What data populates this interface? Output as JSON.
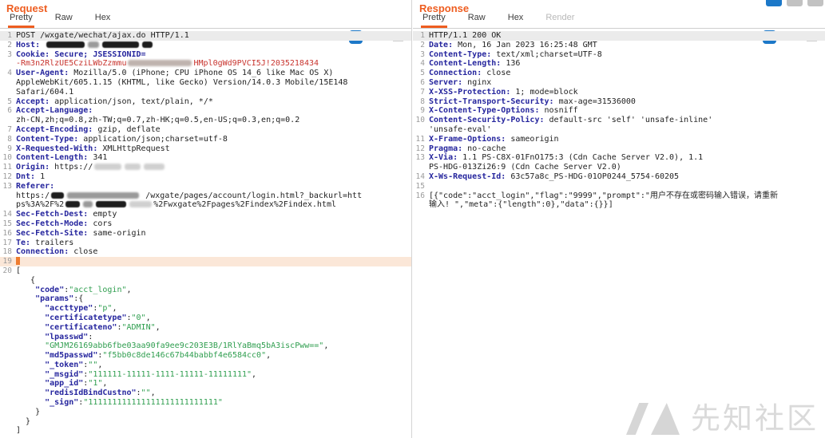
{
  "colors": {
    "accent_orange": "#ee5d20",
    "header_name_blue": "#26269e",
    "json_string_green": "#2f9e4f",
    "cookie_red": "#c8342e",
    "icon_blue": "#1c78c8",
    "selected_line_bg": "#ebebeb",
    "caret_line_bg": "#fbe7d8"
  },
  "watermark": {
    "text": "先知社区",
    "logo": "xianzhi-logo"
  },
  "panels": [
    {
      "id": "request",
      "title": "Request",
      "tabs": [
        {
          "label": "Pretty",
          "state": "active"
        },
        {
          "label": "Raw",
          "state": "normal"
        },
        {
          "label": "Hex",
          "state": "normal"
        }
      ],
      "toolbar": {
        "wrap_icon": "word-wrap-icon",
        "newline_label": "\\n",
        "menu_icon": "hamburger-menu-icon"
      },
      "lines": [
        {
          "n": "1",
          "bg": "sel",
          "s": [
            [
              "t",
              "POST /wxgate/wechat/ajax.do HTTP/1.1"
            ]
          ]
        },
        {
          "n": "2",
          "s": [
            [
              "h",
              "Host:"
            ],
            [
              "t",
              " "
            ],
            [
              "bar-d",
              48
            ],
            [
              "bar-g",
              14
            ],
            [
              "bar-d",
              46
            ],
            [
              "bar-d",
              13
            ]
          ]
        },
        {
          "n": "3",
          "s": [
            [
              "h",
              "Cookie:"
            ],
            [
              "t",
              " "
            ],
            [
              "h",
              "Secure; JSESSIONID="
            ]
          ]
        },
        {
          "n": "",
          "s": [
            [
              "r",
              "-Rm3n2RlzUE5CziLWbZzmmu"
            ],
            [
              "bar-rg",
              80
            ],
            [
              "r",
              "HMpl0gWd9PVCI5J!2035218434"
            ]
          ]
        },
        {
          "n": "4",
          "s": [
            [
              "h",
              "User-Agent:"
            ],
            [
              "t",
              " Mozilla/5.0 (iPhone; CPU iPhone OS 14_6 like Mac OS X)"
            ]
          ]
        },
        {
          "n": "",
          "s": [
            [
              "t",
              "AppleWebKit/605.1.15 (KHTML, like Gecko) Version/14.0.3 Mobile/15E148"
            ]
          ]
        },
        {
          "n": "",
          "s": [
            [
              "t",
              "Safari/604.1"
            ]
          ]
        },
        {
          "n": "5",
          "s": [
            [
              "h",
              "Accept:"
            ],
            [
              "t",
              " application/json, text/plain, */*"
            ]
          ]
        },
        {
          "n": "6",
          "s": [
            [
              "h",
              "Accept-Language:"
            ]
          ]
        },
        {
          "n": "",
          "s": [
            [
              "t",
              "zh-CN,zh;q=0.8,zh-TW;q=0.7,zh-HK;q=0.5,en-US;q=0.3,en;q=0.2"
            ]
          ]
        },
        {
          "n": "7",
          "s": [
            [
              "h",
              "Accept-Encoding:"
            ],
            [
              "t",
              " gzip, deflate"
            ]
          ]
        },
        {
          "n": "8",
          "s": [
            [
              "h",
              "Content-Type:"
            ],
            [
              "t",
              " application/json;charset=utf-8"
            ]
          ]
        },
        {
          "n": "9",
          "s": [
            [
              "h",
              "X-Requested-With:"
            ],
            [
              "t",
              " XMLHttpRequest"
            ]
          ]
        },
        {
          "n": "10",
          "s": [
            [
              "h",
              "Content-Length:"
            ],
            [
              "t",
              " 341"
            ]
          ]
        },
        {
          "n": "11",
          "s": [
            [
              "h",
              "Origin:"
            ],
            [
              "t",
              " https://"
            ],
            [
              "bar-f",
              34
            ],
            [
              "bar-f",
              20
            ],
            [
              "bar-f",
              26
            ]
          ]
        },
        {
          "n": "12",
          "s": [
            [
              "h",
              "Dnt:"
            ],
            [
              "t",
              " 1"
            ]
          ]
        },
        {
          "n": "13",
          "s": [
            [
              "h",
              "Referer:"
            ]
          ]
        },
        {
          "n": "",
          "s": [
            [
              "t",
              "https:/"
            ],
            [
              "bar-d",
              16
            ],
            [
              "bar-g",
              90
            ],
            [
              "t",
              " /wxgate/pages/account/login.html?_backurl=htt"
            ]
          ]
        },
        {
          "n": "",
          "s": [
            [
              "t",
              "ps%3A%2F%2"
            ],
            [
              "bar-d",
              18
            ],
            [
              "bar-g",
              12
            ],
            [
              "bar-d",
              38
            ],
            [
              "bar-f",
              28
            ],
            [
              "t",
              "%2Fwxgate%2Fpages%2Findex%2Findex.html"
            ]
          ]
        },
        {
          "n": "14",
          "s": [
            [
              "h",
              "Sec-Fetch-Dest:"
            ],
            [
              "t",
              " empty"
            ]
          ]
        },
        {
          "n": "15",
          "s": [
            [
              "h",
              "Sec-Fetch-Mode:"
            ],
            [
              "t",
              " cors"
            ]
          ]
        },
        {
          "n": "16",
          "s": [
            [
              "h",
              "Sec-Fetch-Site:"
            ],
            [
              "t",
              " same-origin"
            ]
          ]
        },
        {
          "n": "17",
          "s": [
            [
              "h",
              "Te:"
            ],
            [
              "t",
              " trailers"
            ]
          ]
        },
        {
          "n": "18",
          "s": [
            [
              "h",
              "Connection:"
            ],
            [
              "t",
              " close"
            ]
          ]
        },
        {
          "n": "19",
          "caret": true,
          "s": []
        },
        {
          "n": "20",
          "s": [
            [
              "t",
              "["
            ]
          ]
        },
        {
          "n": "",
          "s": [
            [
              "t",
              "   {"
            ]
          ]
        },
        {
          "n": "",
          "s": [
            [
              "t",
              "    "
            ],
            [
              "h",
              "\"code\""
            ],
            [
              "t",
              ":"
            ],
            [
              "g",
              "\"acct_login\""
            ],
            [
              "t",
              ","
            ]
          ]
        },
        {
          "n": "",
          "s": [
            [
              "t",
              "    "
            ],
            [
              "h",
              "\"params\""
            ],
            [
              "t",
              ":{"
            ]
          ]
        },
        {
          "n": "",
          "s": [
            [
              "t",
              "      "
            ],
            [
              "h",
              "\"accttype\""
            ],
            [
              "t",
              ":"
            ],
            [
              "g",
              "\"p\""
            ],
            [
              "t",
              ","
            ]
          ]
        },
        {
          "n": "",
          "s": [
            [
              "t",
              "      "
            ],
            [
              "h",
              "\"certificatetype\""
            ],
            [
              "t",
              ":"
            ],
            [
              "g",
              "\"0\""
            ],
            [
              "t",
              ","
            ]
          ]
        },
        {
          "n": "",
          "s": [
            [
              "t",
              "      "
            ],
            [
              "h",
              "\"certificateno\""
            ],
            [
              "t",
              ":"
            ],
            [
              "g",
              "\"ADMIN\""
            ],
            [
              "t",
              ","
            ]
          ]
        },
        {
          "n": "",
          "s": [
            [
              "t",
              "      "
            ],
            [
              "h",
              "\"lpasswd\""
            ],
            [
              "t",
              ":"
            ]
          ]
        },
        {
          "n": "",
          "s": [
            [
              "t",
              "      "
            ],
            [
              "g",
              "\"GMJM26169abb6fbe03aa90fa9ee9c203E3B/1RlYaBmq5bA3iscPww==\""
            ],
            [
              "t",
              ","
            ]
          ]
        },
        {
          "n": "",
          "s": [
            [
              "t",
              "      "
            ],
            [
              "h",
              "\"md5passwd\""
            ],
            [
              "t",
              ":"
            ],
            [
              "g",
              "\"f5bb0c8de146c67b44babbf4e6584cc0\""
            ],
            [
              "t",
              ","
            ]
          ]
        },
        {
          "n": "",
          "s": [
            [
              "t",
              "      "
            ],
            [
              "h",
              "\"_token\""
            ],
            [
              "t",
              ":"
            ],
            [
              "g",
              "\"\""
            ],
            [
              "t",
              ","
            ]
          ]
        },
        {
          "n": "",
          "s": [
            [
              "t",
              "      "
            ],
            [
              "h",
              "\"_msgid\""
            ],
            [
              "t",
              ":"
            ],
            [
              "g",
              "\"111111-11111-1111-11111-11111111\""
            ],
            [
              "t",
              ","
            ]
          ]
        },
        {
          "n": "",
          "s": [
            [
              "t",
              "      "
            ],
            [
              "h",
              "\"app_id\""
            ],
            [
              "t",
              ":"
            ],
            [
              "g",
              "\"1\""
            ],
            [
              "t",
              ","
            ]
          ]
        },
        {
          "n": "",
          "s": [
            [
              "t",
              "      "
            ],
            [
              "h",
              "\"redisIdBindCustno\""
            ],
            [
              "t",
              ":"
            ],
            [
              "g",
              "\"\""
            ],
            [
              "t",
              ","
            ]
          ]
        },
        {
          "n": "",
          "s": [
            [
              "t",
              "      "
            ],
            [
              "h",
              "\"_sign\""
            ],
            [
              "t",
              ":"
            ],
            [
              "g",
              "\"111111111111111111111111111\""
            ]
          ]
        },
        {
          "n": "",
          "s": [
            [
              "t",
              "    }"
            ]
          ]
        },
        {
          "n": "",
          "s": [
            [
              "t",
              "  }"
            ]
          ]
        },
        {
          "n": "",
          "s": [
            [
              "t",
              "]"
            ]
          ]
        }
      ]
    },
    {
      "id": "response",
      "title": "Response",
      "tabs": [
        {
          "label": "Pretty",
          "state": "active"
        },
        {
          "label": "Raw",
          "state": "normal"
        },
        {
          "label": "Hex",
          "state": "normal"
        },
        {
          "label": "Render",
          "state": "disabled"
        }
      ],
      "toolbar": {
        "wrap_icon": "word-wrap-icon",
        "newline_label": "\\n",
        "menu_icon": "hamburger-menu-icon"
      },
      "corner_icons": [
        {
          "name": "layout-option-selected",
          "state": "sel"
        },
        {
          "name": "layout-option-2",
          "state": "plain"
        },
        {
          "name": "layout-option-3",
          "state": "plain"
        }
      ],
      "lines": [
        {
          "n": "1",
          "bg": "sel",
          "s": [
            [
              "t",
              "HTTP/1.1 200 OK"
            ]
          ]
        },
        {
          "n": "2",
          "s": [
            [
              "h",
              "Date:"
            ],
            [
              "t",
              " Mon, 16 Jan 2023 16:25:48 GMT"
            ]
          ]
        },
        {
          "n": "3",
          "s": [
            [
              "h",
              "Content-Type:"
            ],
            [
              "t",
              " text/xml;charset=UTF-8"
            ]
          ]
        },
        {
          "n": "4",
          "s": [
            [
              "h",
              "Content-Length:"
            ],
            [
              "t",
              " 136"
            ]
          ]
        },
        {
          "n": "5",
          "s": [
            [
              "h",
              "Connection:"
            ],
            [
              "t",
              " close"
            ]
          ]
        },
        {
          "n": "6",
          "s": [
            [
              "h",
              "Server:"
            ],
            [
              "t",
              " nginx"
            ]
          ]
        },
        {
          "n": "7",
          "s": [
            [
              "h",
              "X-XSS-Protection:"
            ],
            [
              "t",
              " 1; mode=block"
            ]
          ]
        },
        {
          "n": "8",
          "s": [
            [
              "h",
              "Strict-Transport-Security:"
            ],
            [
              "t",
              " max-age=31536000"
            ]
          ]
        },
        {
          "n": "9",
          "s": [
            [
              "h",
              "X-Content-Type-Options:"
            ],
            [
              "t",
              " nosniff"
            ]
          ]
        },
        {
          "n": "10",
          "s": [
            [
              "h",
              "Content-Security-Policy:"
            ],
            [
              "t",
              " default-src 'self' 'unsafe-inline'"
            ]
          ]
        },
        {
          "n": "",
          "s": [
            [
              "t",
              "'unsafe-eval'"
            ]
          ]
        },
        {
          "n": "11",
          "s": [
            [
              "h",
              "X-Frame-Options:"
            ],
            [
              "t",
              " sameorigin"
            ]
          ]
        },
        {
          "n": "12",
          "s": [
            [
              "h",
              "Pragma:"
            ],
            [
              "t",
              " no-cache"
            ]
          ]
        },
        {
          "n": "13",
          "s": [
            [
              "h",
              "X-Via:"
            ],
            [
              "t",
              " 1.1 PS-C8X-01FnO175:3 (Cdn Cache Server V2.0), 1.1"
            ]
          ]
        },
        {
          "n": "",
          "s": [
            [
              "t",
              "PS-HDG-013Zi26:9 (Cdn Cache Server V2.0)"
            ]
          ]
        },
        {
          "n": "14",
          "s": [
            [
              "h",
              "X-Ws-Request-Id:"
            ],
            [
              "t",
              " 63c57a8c_PS-HDG-01OP0244_5754-60205"
            ]
          ]
        },
        {
          "n": "15",
          "s": []
        },
        {
          "n": "16",
          "s": [
            [
              "t",
              "[{\"code\":\"acct_login\",\"flag\":\"9999\",\"prompt\":\"用户不存在或密码输入错误，请重新"
            ]
          ]
        },
        {
          "n": "",
          "s": [
            [
              "t",
              "输入! \",\"meta\":{\"length\":0},\"data\":{}}]"
            ]
          ]
        }
      ]
    }
  ]
}
